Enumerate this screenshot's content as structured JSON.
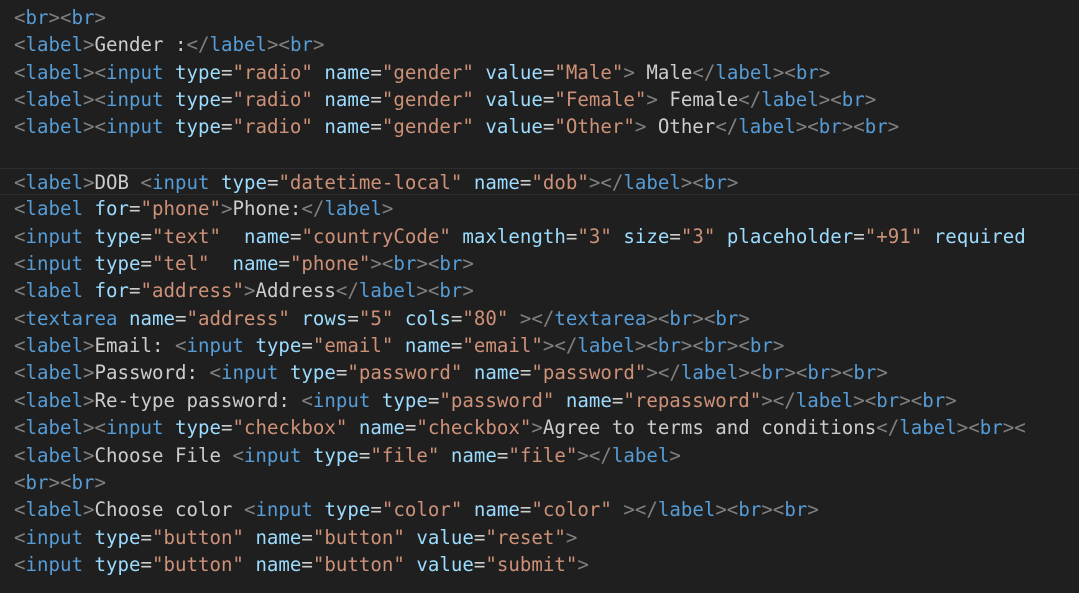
{
  "colors": {
    "background": "#1f1f1f",
    "tag": "#569cd6",
    "bracket": "#808080",
    "attribute": "#9cdcfe",
    "string": "#ce9178",
    "text": "#cccccc"
  },
  "current_line_index": 6,
  "lines": [
    [
      [
        "p",
        "<"
      ],
      [
        "t",
        "br"
      ],
      [
        "p",
        "><"
      ],
      [
        "t",
        "br"
      ],
      [
        "p",
        ">"
      ]
    ],
    [
      [
        "p",
        "<"
      ],
      [
        "t",
        "label"
      ],
      [
        "p",
        ">"
      ],
      [
        "x",
        "Gender :"
      ],
      [
        "p",
        "</"
      ],
      [
        "t",
        "label"
      ],
      [
        "p",
        "><"
      ],
      [
        "t",
        "br"
      ],
      [
        "p",
        ">"
      ]
    ],
    [
      [
        "p",
        "<"
      ],
      [
        "t",
        "label"
      ],
      [
        "p",
        "><"
      ],
      [
        "t",
        "input"
      ],
      [
        "x",
        " "
      ],
      [
        "a",
        "type"
      ],
      [
        "x",
        "="
      ],
      [
        "s",
        "\"radio\""
      ],
      [
        "x",
        " "
      ],
      [
        "a",
        "name"
      ],
      [
        "x",
        "="
      ],
      [
        "s",
        "\"gender\""
      ],
      [
        "x",
        " "
      ],
      [
        "a",
        "value"
      ],
      [
        "x",
        "="
      ],
      [
        "s",
        "\"Male\""
      ],
      [
        "p",
        ">"
      ],
      [
        "x",
        " Male"
      ],
      [
        "p",
        "</"
      ],
      [
        "t",
        "label"
      ],
      [
        "p",
        "><"
      ],
      [
        "t",
        "br"
      ],
      [
        "p",
        ">"
      ]
    ],
    [
      [
        "p",
        "<"
      ],
      [
        "t",
        "label"
      ],
      [
        "p",
        "><"
      ],
      [
        "t",
        "input"
      ],
      [
        "x",
        " "
      ],
      [
        "a",
        "type"
      ],
      [
        "x",
        "="
      ],
      [
        "s",
        "\"radio\""
      ],
      [
        "x",
        " "
      ],
      [
        "a",
        "name"
      ],
      [
        "x",
        "="
      ],
      [
        "s",
        "\"gender\""
      ],
      [
        "x",
        " "
      ],
      [
        "a",
        "value"
      ],
      [
        "x",
        "="
      ],
      [
        "s",
        "\"Female\""
      ],
      [
        "p",
        ">"
      ],
      [
        "x",
        " Female"
      ],
      [
        "p",
        "</"
      ],
      [
        "t",
        "label"
      ],
      [
        "p",
        "><"
      ],
      [
        "t",
        "br"
      ],
      [
        "p",
        ">"
      ]
    ],
    [
      [
        "p",
        "<"
      ],
      [
        "t",
        "label"
      ],
      [
        "p",
        "><"
      ],
      [
        "t",
        "input"
      ],
      [
        "x",
        " "
      ],
      [
        "a",
        "type"
      ],
      [
        "x",
        "="
      ],
      [
        "s",
        "\"radio\""
      ],
      [
        "x",
        " "
      ],
      [
        "a",
        "name"
      ],
      [
        "x",
        "="
      ],
      [
        "s",
        "\"gender\""
      ],
      [
        "x",
        " "
      ],
      [
        "a",
        "value"
      ],
      [
        "x",
        "="
      ],
      [
        "s",
        "\"Other\""
      ],
      [
        "p",
        ">"
      ],
      [
        "x",
        " Other"
      ],
      [
        "p",
        "</"
      ],
      [
        "t",
        "label"
      ],
      [
        "p",
        "><"
      ],
      [
        "t",
        "br"
      ],
      [
        "p",
        "><"
      ],
      [
        "t",
        "br"
      ],
      [
        "p",
        ">"
      ]
    ],
    [],
    [
      [
        "p",
        "<"
      ],
      [
        "t",
        "label"
      ],
      [
        "p",
        ">"
      ],
      [
        "x",
        "DOB "
      ],
      [
        "p",
        "<"
      ],
      [
        "t",
        "input"
      ],
      [
        "x",
        " "
      ],
      [
        "a",
        "type"
      ],
      [
        "x",
        "="
      ],
      [
        "s",
        "\"datetime-local\""
      ],
      [
        "x",
        " "
      ],
      [
        "a",
        "name"
      ],
      [
        "x",
        "="
      ],
      [
        "s",
        "\"dob\""
      ],
      [
        "p",
        "></"
      ],
      [
        "t",
        "label"
      ],
      [
        "p",
        "><"
      ],
      [
        "t",
        "br"
      ],
      [
        "p",
        ">"
      ]
    ],
    [
      [
        "p",
        "<"
      ],
      [
        "t",
        "label"
      ],
      [
        "x",
        " "
      ],
      [
        "a",
        "for"
      ],
      [
        "x",
        "="
      ],
      [
        "s",
        "\"phone\""
      ],
      [
        "p",
        ">"
      ],
      [
        "x",
        "Phone:"
      ],
      [
        "p",
        "</"
      ],
      [
        "t",
        "label"
      ],
      [
        "p",
        ">"
      ]
    ],
    [
      [
        "p",
        "<"
      ],
      [
        "t",
        "input"
      ],
      [
        "x",
        " "
      ],
      [
        "a",
        "type"
      ],
      [
        "x",
        "="
      ],
      [
        "s",
        "\"text\""
      ],
      [
        "x",
        "  "
      ],
      [
        "a",
        "name"
      ],
      [
        "x",
        "="
      ],
      [
        "s",
        "\"countryCode\""
      ],
      [
        "x",
        " "
      ],
      [
        "a",
        "maxlength"
      ],
      [
        "x",
        "="
      ],
      [
        "s",
        "\"3\""
      ],
      [
        "x",
        " "
      ],
      [
        "a",
        "size"
      ],
      [
        "x",
        "="
      ],
      [
        "s",
        "\"3\""
      ],
      [
        "x",
        " "
      ],
      [
        "a",
        "placeholder"
      ],
      [
        "x",
        "="
      ],
      [
        "s",
        "\"+91\""
      ],
      [
        "x",
        " "
      ],
      [
        "a",
        "required"
      ]
    ],
    [
      [
        "p",
        "<"
      ],
      [
        "t",
        "input"
      ],
      [
        "x",
        " "
      ],
      [
        "a",
        "type"
      ],
      [
        "x",
        "="
      ],
      [
        "s",
        "\"tel\""
      ],
      [
        "x",
        "  "
      ],
      [
        "a",
        "name"
      ],
      [
        "x",
        "="
      ],
      [
        "s",
        "\"phone\""
      ],
      [
        "p",
        "><"
      ],
      [
        "t",
        "br"
      ],
      [
        "p",
        "><"
      ],
      [
        "t",
        "br"
      ],
      [
        "p",
        ">"
      ]
    ],
    [
      [
        "p",
        "<"
      ],
      [
        "t",
        "label"
      ],
      [
        "x",
        " "
      ],
      [
        "a",
        "for"
      ],
      [
        "x",
        "="
      ],
      [
        "s",
        "\"address\""
      ],
      [
        "p",
        ">"
      ],
      [
        "x",
        "Address"
      ],
      [
        "p",
        "</"
      ],
      [
        "t",
        "label"
      ],
      [
        "p",
        "><"
      ],
      [
        "t",
        "br"
      ],
      [
        "p",
        ">"
      ]
    ],
    [
      [
        "p",
        "<"
      ],
      [
        "t",
        "textarea"
      ],
      [
        "x",
        " "
      ],
      [
        "a",
        "name"
      ],
      [
        "x",
        "="
      ],
      [
        "s",
        "\"address\""
      ],
      [
        "x",
        " "
      ],
      [
        "a",
        "rows"
      ],
      [
        "x",
        "="
      ],
      [
        "s",
        "\"5\""
      ],
      [
        "x",
        " "
      ],
      [
        "a",
        "cols"
      ],
      [
        "x",
        "="
      ],
      [
        "s",
        "\"80\""
      ],
      [
        "x",
        " "
      ],
      [
        "p",
        "></"
      ],
      [
        "t",
        "textarea"
      ],
      [
        "p",
        "><"
      ],
      [
        "t",
        "br"
      ],
      [
        "p",
        "><"
      ],
      [
        "t",
        "br"
      ],
      [
        "p",
        ">"
      ]
    ],
    [
      [
        "p",
        "<"
      ],
      [
        "t",
        "label"
      ],
      [
        "p",
        ">"
      ],
      [
        "x",
        "Email: "
      ],
      [
        "p",
        "<"
      ],
      [
        "t",
        "input"
      ],
      [
        "x",
        " "
      ],
      [
        "a",
        "type"
      ],
      [
        "x",
        "="
      ],
      [
        "s",
        "\"email\""
      ],
      [
        "x",
        " "
      ],
      [
        "a",
        "name"
      ],
      [
        "x",
        "="
      ],
      [
        "s",
        "\"email\""
      ],
      [
        "p",
        "></"
      ],
      [
        "t",
        "label"
      ],
      [
        "p",
        "><"
      ],
      [
        "t",
        "br"
      ],
      [
        "p",
        "><"
      ],
      [
        "t",
        "br"
      ],
      [
        "p",
        "><"
      ],
      [
        "t",
        "br"
      ],
      [
        "p",
        ">"
      ]
    ],
    [
      [
        "p",
        "<"
      ],
      [
        "t",
        "label"
      ],
      [
        "p",
        ">"
      ],
      [
        "x",
        "Password: "
      ],
      [
        "p",
        "<"
      ],
      [
        "t",
        "input"
      ],
      [
        "x",
        " "
      ],
      [
        "a",
        "type"
      ],
      [
        "x",
        "="
      ],
      [
        "s",
        "\"password\""
      ],
      [
        "x",
        " "
      ],
      [
        "a",
        "name"
      ],
      [
        "x",
        "="
      ],
      [
        "s",
        "\"password\""
      ],
      [
        "p",
        "></"
      ],
      [
        "t",
        "label"
      ],
      [
        "p",
        "><"
      ],
      [
        "t",
        "br"
      ],
      [
        "p",
        "><"
      ],
      [
        "t",
        "br"
      ],
      [
        "p",
        "><"
      ],
      [
        "t",
        "br"
      ],
      [
        "p",
        ">"
      ]
    ],
    [
      [
        "p",
        "<"
      ],
      [
        "t",
        "label"
      ],
      [
        "p",
        ">"
      ],
      [
        "x",
        "Re-type password: "
      ],
      [
        "p",
        "<"
      ],
      [
        "t",
        "input"
      ],
      [
        "x",
        " "
      ],
      [
        "a",
        "type"
      ],
      [
        "x",
        "="
      ],
      [
        "s",
        "\"password\""
      ],
      [
        "x",
        " "
      ],
      [
        "a",
        "name"
      ],
      [
        "x",
        "="
      ],
      [
        "s",
        "\"repassword\""
      ],
      [
        "p",
        "></"
      ],
      [
        "t",
        "label"
      ],
      [
        "p",
        "><"
      ],
      [
        "t",
        "br"
      ],
      [
        "p",
        "><"
      ],
      [
        "t",
        "br"
      ],
      [
        "p",
        ">"
      ]
    ],
    [
      [
        "p",
        "<"
      ],
      [
        "t",
        "label"
      ],
      [
        "p",
        "><"
      ],
      [
        "t",
        "input"
      ],
      [
        "x",
        " "
      ],
      [
        "a",
        "type"
      ],
      [
        "x",
        "="
      ],
      [
        "s",
        "\"checkbox\""
      ],
      [
        "x",
        " "
      ],
      [
        "a",
        "name"
      ],
      [
        "x",
        "="
      ],
      [
        "s",
        "\"checkbox\""
      ],
      [
        "p",
        ">"
      ],
      [
        "x",
        "Agree to terms and conditions"
      ],
      [
        "p",
        "</"
      ],
      [
        "t",
        "label"
      ],
      [
        "p",
        "><"
      ],
      [
        "t",
        "br"
      ],
      [
        "p",
        "><"
      ]
    ],
    [
      [
        "p",
        "<"
      ],
      [
        "t",
        "label"
      ],
      [
        "p",
        ">"
      ],
      [
        "x",
        "Choose File "
      ],
      [
        "p",
        "<"
      ],
      [
        "t",
        "input"
      ],
      [
        "x",
        " "
      ],
      [
        "a",
        "type"
      ],
      [
        "x",
        "="
      ],
      [
        "s",
        "\"file\""
      ],
      [
        "x",
        " "
      ],
      [
        "a",
        "name"
      ],
      [
        "x",
        "="
      ],
      [
        "s",
        "\"file\""
      ],
      [
        "p",
        "></"
      ],
      [
        "t",
        "label"
      ],
      [
        "p",
        ">"
      ]
    ],
    [
      [
        "p",
        "<"
      ],
      [
        "t",
        "br"
      ],
      [
        "p",
        "><"
      ],
      [
        "t",
        "br"
      ],
      [
        "p",
        ">"
      ]
    ],
    [
      [
        "p",
        "<"
      ],
      [
        "t",
        "label"
      ],
      [
        "p",
        ">"
      ],
      [
        "x",
        "Choose color "
      ],
      [
        "p",
        "<"
      ],
      [
        "t",
        "input"
      ],
      [
        "x",
        " "
      ],
      [
        "a",
        "type"
      ],
      [
        "x",
        "="
      ],
      [
        "s",
        "\"color\""
      ],
      [
        "x",
        " "
      ],
      [
        "a",
        "name"
      ],
      [
        "x",
        "="
      ],
      [
        "s",
        "\"color\""
      ],
      [
        "x",
        " "
      ],
      [
        "p",
        "></"
      ],
      [
        "t",
        "label"
      ],
      [
        "p",
        "><"
      ],
      [
        "t",
        "br"
      ],
      [
        "p",
        "><"
      ],
      [
        "t",
        "br"
      ],
      [
        "p",
        ">"
      ]
    ],
    [
      [
        "p",
        "<"
      ],
      [
        "t",
        "input"
      ],
      [
        "x",
        " "
      ],
      [
        "a",
        "type"
      ],
      [
        "x",
        "="
      ],
      [
        "s",
        "\"button\""
      ],
      [
        "x",
        " "
      ],
      [
        "a",
        "name"
      ],
      [
        "x",
        "="
      ],
      [
        "s",
        "\"button\""
      ],
      [
        "x",
        " "
      ],
      [
        "a",
        "value"
      ],
      [
        "x",
        "="
      ],
      [
        "s",
        "\"reset\""
      ],
      [
        "p",
        ">"
      ]
    ],
    [
      [
        "p",
        "<"
      ],
      [
        "t",
        "input"
      ],
      [
        "x",
        " "
      ],
      [
        "a",
        "type"
      ],
      [
        "x",
        "="
      ],
      [
        "s",
        "\"button\""
      ],
      [
        "x",
        " "
      ],
      [
        "a",
        "name"
      ],
      [
        "x",
        "="
      ],
      [
        "s",
        "\"button\""
      ],
      [
        "x",
        " "
      ],
      [
        "a",
        "value"
      ],
      [
        "x",
        "="
      ],
      [
        "s",
        "\"submit\""
      ],
      [
        "p",
        ">"
      ]
    ]
  ]
}
